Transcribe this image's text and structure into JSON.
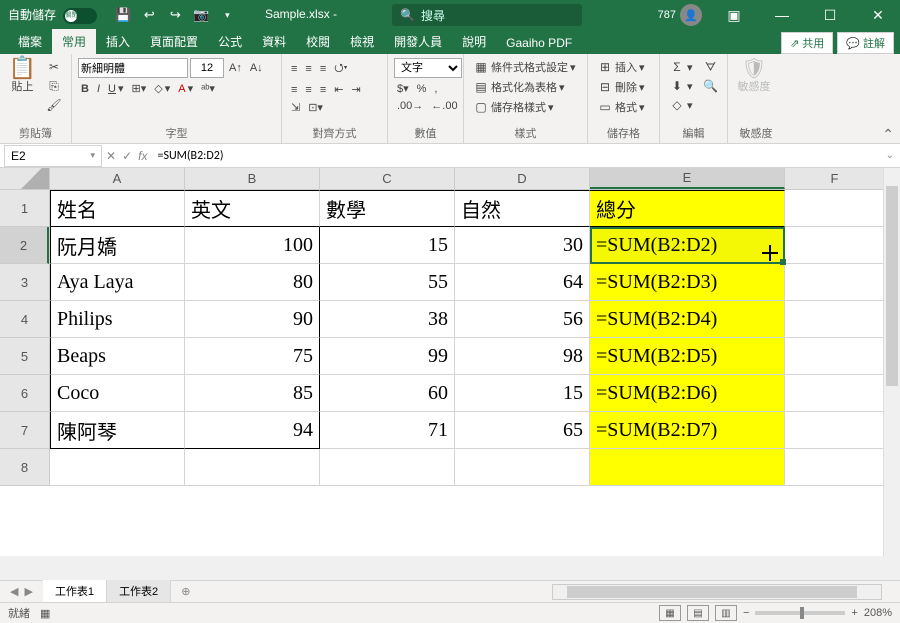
{
  "titlebar": {
    "autosave_label": "自動儲存",
    "autosave_state": "關閉",
    "filename": "Sample.xlsx  -",
    "search_placeholder": "搜尋",
    "account_num": "787"
  },
  "tabs": {
    "items": [
      "檔案",
      "常用",
      "插入",
      "頁面配置",
      "公式",
      "資料",
      "校閱",
      "檢視",
      "開發人員",
      "說明",
      "Gaaiho PDF"
    ],
    "active_index": 1,
    "share": "共用",
    "comments": "註解"
  },
  "ribbon": {
    "clipboard": {
      "label": "剪貼簿",
      "paste": "貼上"
    },
    "font": {
      "label": "字型",
      "name": "新細明體",
      "size": "12"
    },
    "align": {
      "label": "對齊方式"
    },
    "number": {
      "label": "數值",
      "format": "文字"
    },
    "styles": {
      "label": "樣式",
      "cond": "條件式格式設定",
      "table": "格式化為表格",
      "cell": "儲存格樣式"
    },
    "cells": {
      "label": "儲存格",
      "insert": "插入",
      "delete": "刪除",
      "format": "格式"
    },
    "editing": {
      "label": "編輯"
    },
    "sensitivity": {
      "label": "敏感度",
      "btn": "敏感度"
    }
  },
  "formula_bar": {
    "cell_ref": "E2",
    "formula": "=SUM(B2:D2)"
  },
  "grid": {
    "col_widths": {
      "A": 135,
      "B": 135,
      "C": 135,
      "D": 135,
      "E": 195,
      "F": 100
    },
    "headers": [
      "A",
      "B",
      "C",
      "D",
      "E",
      "F"
    ],
    "rows": [
      {
        "n": 1,
        "A": "姓名",
        "B": "英文",
        "C": "數學",
        "D": "自然",
        "E": "總分"
      },
      {
        "n": 2,
        "A": "阮月嬌",
        "B": "100",
        "C": "15",
        "D": "30",
        "E": "=SUM(B2:D2)"
      },
      {
        "n": 3,
        "A": "Aya Laya",
        "B": "80",
        "C": "55",
        "D": "64",
        "E": "=SUM(B2:D3)"
      },
      {
        "n": 4,
        "A": "Philips",
        "B": "90",
        "C": "38",
        "D": "56",
        "E": "=SUM(B2:D4)"
      },
      {
        "n": 5,
        "A": "Beaps",
        "B": "75",
        "C": "99",
        "D": "98",
        "E": "=SUM(B2:D5)"
      },
      {
        "n": 6,
        "A": "Coco",
        "B": "85",
        "C": "60",
        "D": "15",
        "E": "=SUM(B2:D6)"
      },
      {
        "n": 7,
        "A": "陳阿琴",
        "B": "94",
        "C": "71",
        "D": "65",
        "E": "=SUM(B2:D7)"
      },
      {
        "n": 8,
        "A": "",
        "B": "",
        "C": "",
        "D": "",
        "E": ""
      }
    ]
  },
  "sheets": {
    "tabs": [
      "工作表1",
      "工作表2"
    ],
    "active_index": 0
  },
  "status": {
    "ready": "就緒",
    "zoom": "208%"
  }
}
